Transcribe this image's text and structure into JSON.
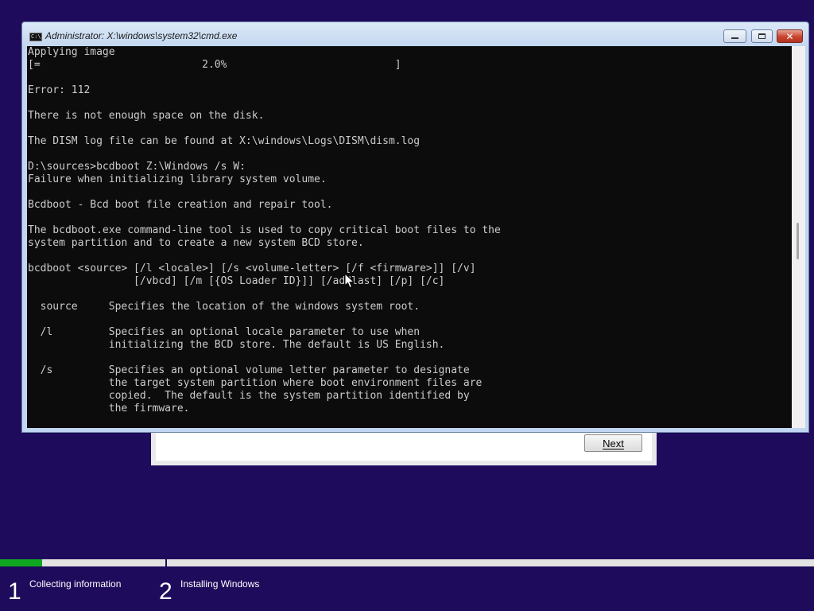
{
  "console_window": {
    "title": "Administrator: X:\\windows\\system32\\cmd.exe",
    "icon_text": "C:\\",
    "lines": [
      "Applying image",
      "[=                          2.0%                           ]",
      "",
      "Error: 112",
      "",
      "There is not enough space on the disk.",
      "",
      "The DISM log file can be found at X:\\windows\\Logs\\DISM\\dism.log",
      "",
      "D:\\sources>bcdboot Z:\\Windows /s W:",
      "Failure when initializing library system volume.",
      "",
      "Bcdboot - Bcd boot file creation and repair tool.",
      "",
      "The bcdboot.exe command-line tool is used to copy critical boot files to the",
      "system partition and to create a new system BCD store.",
      "",
      "bcdboot <source> [/l <locale>] [/s <volume-letter> [/f <firmware>]] [/v]",
      "                 [/vbcd] [/m [{OS Loader ID}]] [/addlast] [/p] [/c]",
      "",
      "  source     Specifies the location of the windows system root.",
      "",
      "  /l         Specifies an optional locale parameter to use when",
      "             initializing the BCD store. The default is US English.",
      "",
      "  /s         Specifies an optional volume letter parameter to designate",
      "             the target system partition where boot environment files are",
      "             copied.  The default is the system partition identified by",
      "             the firmware."
    ],
    "close_glyph": "✕"
  },
  "setup_dialog": {
    "next_label": "Next"
  },
  "setup_progress": {
    "percent": 5.2,
    "steps": [
      {
        "number": "1",
        "label": "Collecting information"
      },
      {
        "number": "2",
        "label": "Installing Windows"
      }
    ]
  },
  "colors": {
    "background": "#1f0b5c",
    "progress_fill": "#10a821",
    "console_bg": "#0c0c0c",
    "console_text": "#cccccc"
  }
}
